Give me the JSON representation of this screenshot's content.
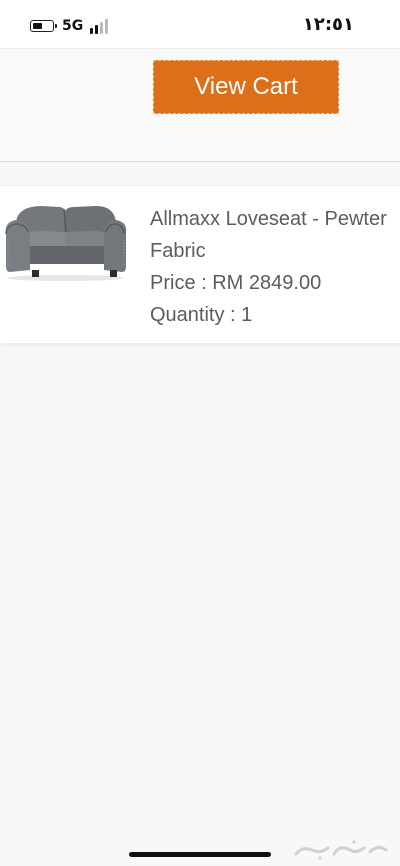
{
  "status_bar": {
    "network": "5G",
    "time": "١٢:٥١",
    "battery_level": 0.55
  },
  "cart": {
    "view_cart_label": "View Cart"
  },
  "product": {
    "name_line1": "Allmaxx Loveseat - Pewter",
    "name_line2": "Fabric",
    "price": "Price : RM 2849.00",
    "quantity": "Quantity : 1",
    "image": "gray-loveseat-sofa-image"
  },
  "colors": {
    "accent": "#dd6f1b",
    "background": "#f8f8f9",
    "text": "#5c5c5c"
  },
  "watermark": {
    "image": "haraj-watermark-logo"
  }
}
